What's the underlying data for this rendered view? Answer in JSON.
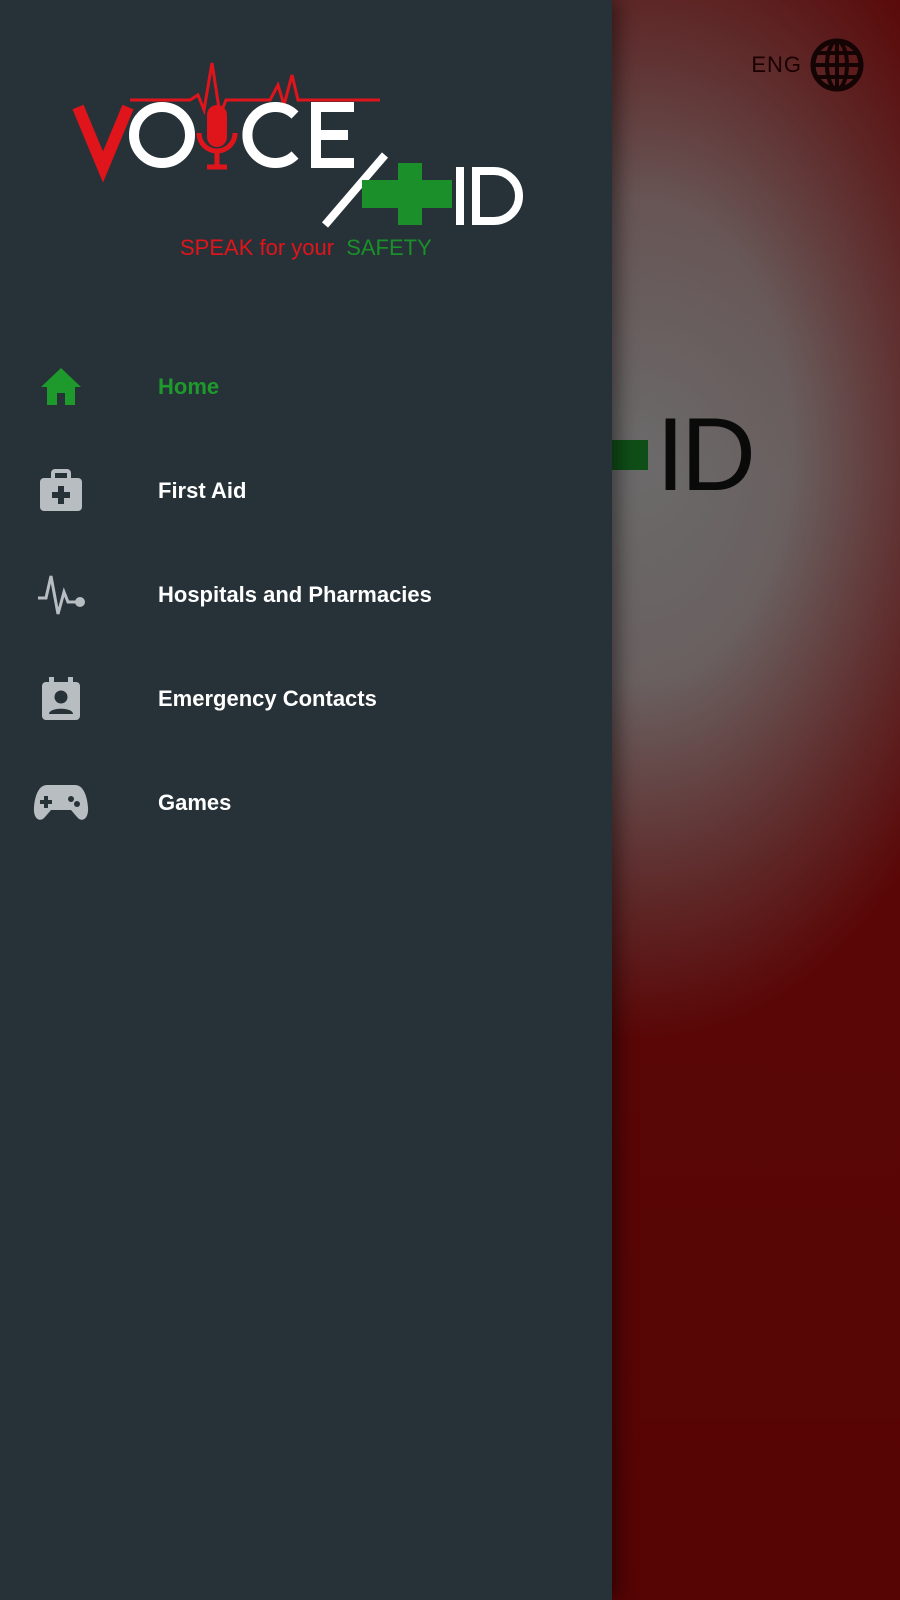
{
  "language": {
    "label": "ENG",
    "icon": "globe-icon"
  },
  "background": {
    "logo_fragment": "ID"
  },
  "logo": {
    "brand_left": "VOICE",
    "brand_right": "AID",
    "tagline_part1": "SPEAK for your",
    "tagline_part2": "SAFETY",
    "colors": {
      "red": "#e0141b",
      "green": "#1a8f2a",
      "white": "#ffffff"
    }
  },
  "drawer": {
    "items": [
      {
        "label": "Home",
        "icon": "home-icon",
        "active": true
      },
      {
        "label": "First Aid",
        "icon": "first-aid-kit-icon",
        "active": false
      },
      {
        "label": "Hospitals and Pharmacies",
        "icon": "heartbeat-icon",
        "active": false
      },
      {
        "label": "Emergency Contacts",
        "icon": "contact-badge-icon",
        "active": false
      },
      {
        "label": "Games",
        "icon": "gamepad-icon",
        "active": false
      }
    ]
  },
  "colors": {
    "drawer_bg": "#263238",
    "active": "#1e9a2c",
    "icon": "#b8bdc1",
    "accent_red": "#5a0000"
  }
}
